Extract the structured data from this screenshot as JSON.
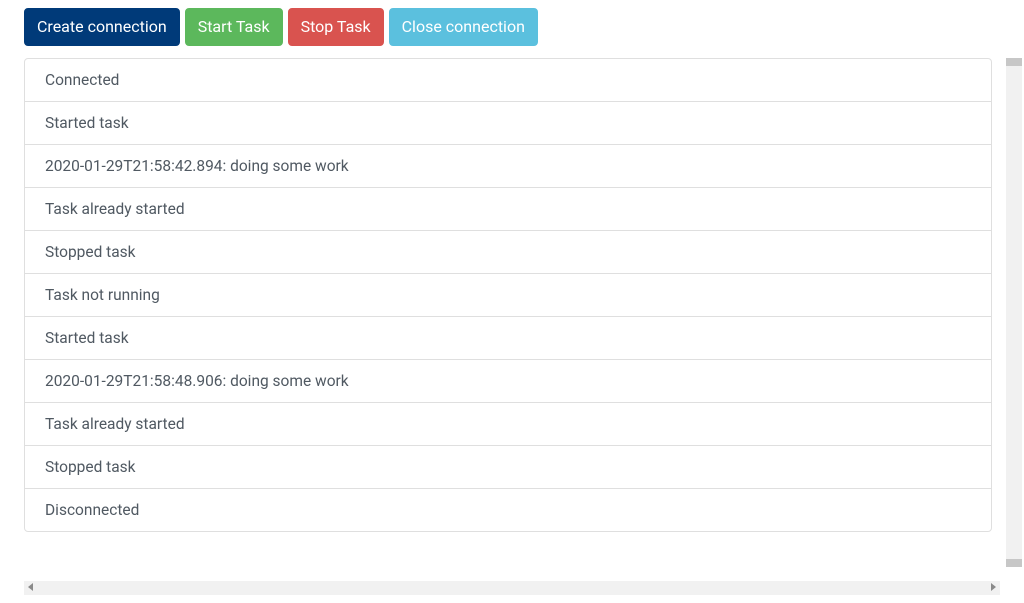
{
  "toolbar": {
    "create_connection_label": "Create connection",
    "start_task_label": "Start Task",
    "stop_task_label": "Stop Task",
    "close_connection_label": "Close connection"
  },
  "log": {
    "items": [
      "Connected",
      "Started task",
      "2020-01-29T21:58:42.894: doing some work",
      "Task already started",
      "Stopped task",
      "Task not running",
      "Started task",
      "2020-01-29T21:58:48.906: doing some work",
      "Task already started",
      "Stopped task",
      "Disconnected"
    ]
  }
}
